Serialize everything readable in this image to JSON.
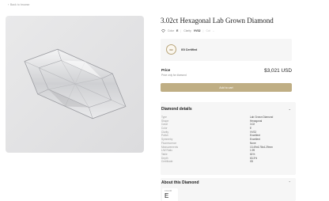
{
  "nav": {
    "back_label": "Back to browse"
  },
  "product": {
    "title": "3.02ct Hexagonal Lab Grown Diamond",
    "meta": {
      "color_label": "Color",
      "color_value": "E",
      "clarity_label": "Clarity",
      "clarity_value": "VVS2",
      "cut_label": "Cut",
      "cut_value": "--"
    },
    "certification": {
      "badge": "IGI",
      "label": "IGI Certified"
    },
    "price": {
      "label": "Price",
      "subtext": "Price only for diamond",
      "value": "$3,021 USD"
    },
    "add_to_cart_label": "Add to cart"
  },
  "details": {
    "heading": "Diamond details",
    "rows": [
      {
        "key": "Type",
        "value": "Lab Grown Diamond"
      },
      {
        "key": "Shape",
        "value": "Hexagonal"
      },
      {
        "key": "Carat",
        "value": "3.02"
      },
      {
        "key": "Color",
        "value": "E"
      },
      {
        "key": "Clarity",
        "value": "VVS2"
      },
      {
        "key": "Polish",
        "value": "Excellent"
      },
      {
        "key": "Symmetry",
        "value": "Excellent"
      },
      {
        "key": "Fluorescence",
        "value": "None"
      },
      {
        "key": "Measurements",
        "value": "13.49x6.78x4.29mm"
      },
      {
        "key": "L/W Ratio",
        "value": "1.99"
      },
      {
        "key": "Table",
        "value": "61%"
      },
      {
        "key": "Depth",
        "value": "63.3%"
      },
      {
        "key": "Certificate",
        "value": "IGI"
      }
    ]
  },
  "about": {
    "heading": "About this Diamond",
    "color_card_label": "COLOR",
    "color_card_value": "E"
  },
  "colors": {
    "accent": "#bfae84",
    "panel": "#f6f6f6",
    "image_bg": "#e2e2e3"
  }
}
